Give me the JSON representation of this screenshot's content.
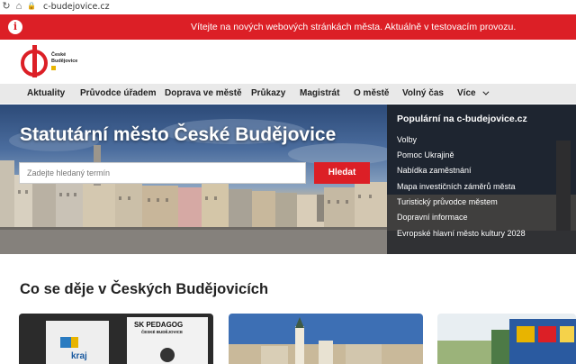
{
  "browser": {
    "url": "c-budejovice.cz"
  },
  "alert": {
    "message": "Vítejte na nových webových stránkách města. Aktuálně v testovacím provozu."
  },
  "logo": {
    "line1": "České",
    "line2": "Budějovice"
  },
  "nav": {
    "items": [
      "Aktuality",
      "Průvodce úřadem",
      "Doprava ve městě",
      "Průkazy",
      "Magistrát",
      "O městě",
      "Volný čas",
      "Více"
    ]
  },
  "hero": {
    "title": "Statutární město České Budějovice",
    "search_placeholder": "Zadejte hledaný termín",
    "search_button": "Hledat"
  },
  "popular": {
    "title": "Populární na c-budejovice.cz",
    "links": [
      "Volby",
      "Pomoc Ukrajině",
      "Nabídka zaměstnání",
      "Mapa investičních záměrů města",
      "Turistický průvodce městem",
      "Dopravní informace",
      "Evropské hlavní město kultury 2028"
    ]
  },
  "section": {
    "title": "Co se děje v Českých Budějovicích"
  },
  "cards": {
    "card1_sign": "SK PEDAGOG",
    "card1_sign2": "ČESKÉ BUDĚJOVICE",
    "card1_text": "kraj"
  },
  "colors": {
    "accent": "#dc1f26",
    "nav_bg": "#e9e9e9"
  }
}
